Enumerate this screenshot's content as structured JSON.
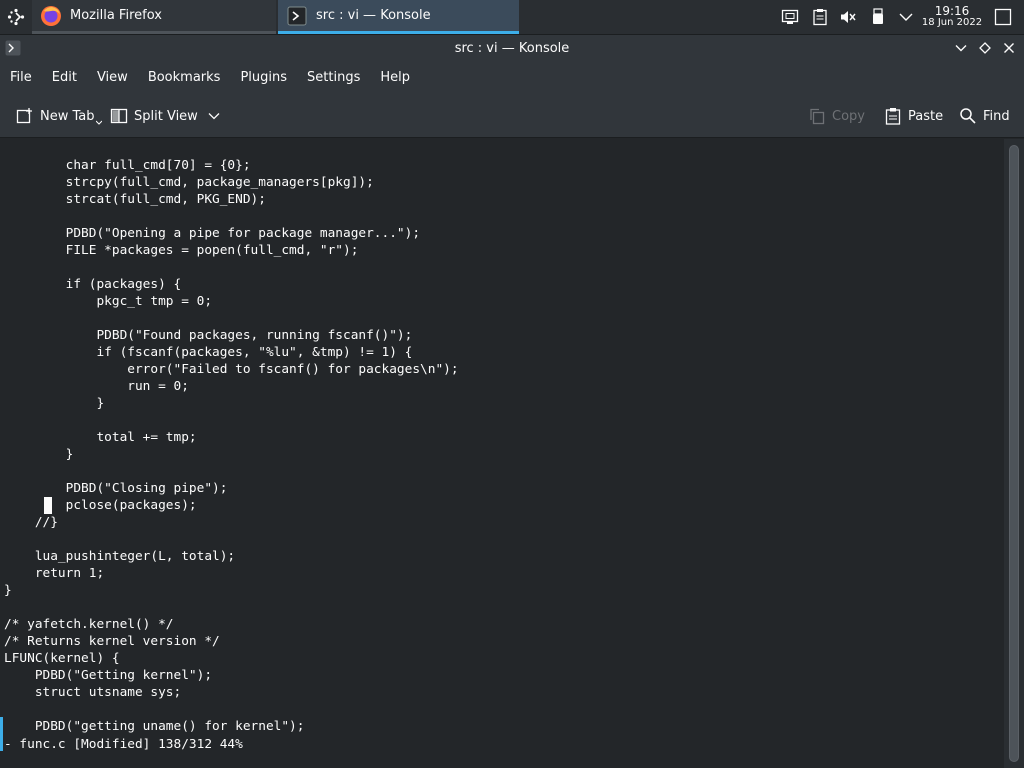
{
  "taskbar": {
    "tasks": [
      {
        "label": "Mozilla Firefox",
        "icon": "firefox-icon"
      },
      {
        "label": "src : vi — Konsole",
        "icon": "konsole-icon"
      }
    ],
    "clock": {
      "time": "19:16",
      "date": "18 Jun 2022"
    }
  },
  "window": {
    "title": "src : vi — Konsole"
  },
  "menu": [
    "File",
    "Edit",
    "View",
    "Bookmarks",
    "Plugins",
    "Settings",
    "Help"
  ],
  "toolbar": {
    "new_tab": "New Tab",
    "split_view": "Split View",
    "copy": "Copy",
    "paste": "Paste",
    "find": "Find"
  },
  "terminal": {
    "code": "        char full_cmd[70] = {0};\n        strcpy(full_cmd, package_managers[pkg]);\n        strcat(full_cmd, PKG_END);\n\n        PDBD(\"Opening a pipe for package manager...\");\n        FILE *packages = popen(full_cmd, \"r\");\n\n        if (packages) {\n            pkgc_t tmp = 0;\n\n            PDBD(\"Found packages, running fscanf()\");\n            if (fscanf(packages, \"%lu\", &tmp) != 1) {\n                error(\"Failed to fscanf() for packages\\n\");\n                run = 0;\n            }\n\n            total += tmp;\n        }\n\n        PDBD(\"Closing pipe\");\n        pclose(packages);\n    //}\n\n    lua_pushinteger(L, total);\n    return 1;\n}\n\n/* yafetch.kernel() */\n/* Returns kernel version */\nLFUNC(kernel) {\n    PDBD(\"Getting kernel\");\n    struct utsname sys;\n\n    PDBD(\"getting uname() for kernel\");",
    "status": "- func.c [Modified] 138/312 44%"
  },
  "colors": {
    "accent": "#3daee9",
    "background": "#232629",
    "chrome": "#31363b"
  }
}
